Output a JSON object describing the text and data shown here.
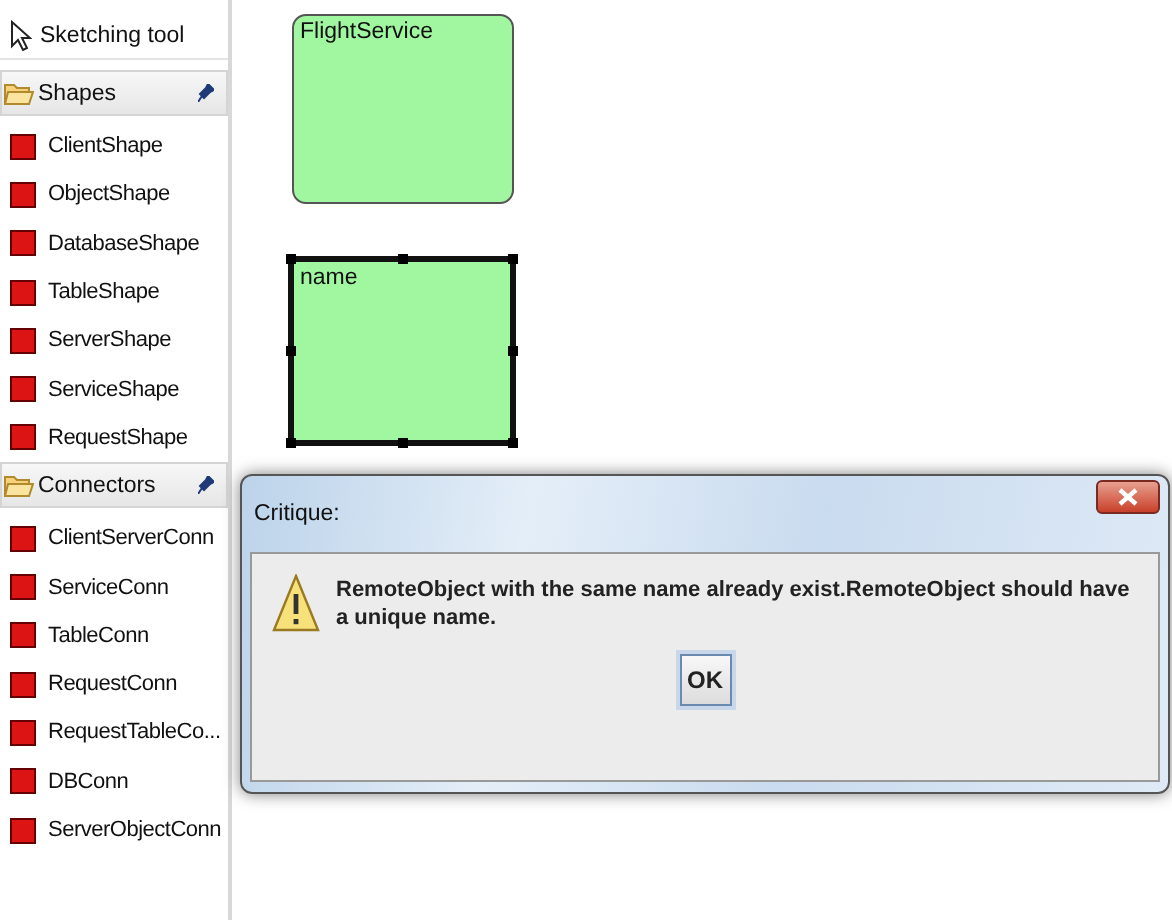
{
  "palette": {
    "tool": {
      "label": "Sketching tool"
    },
    "groups": [
      {
        "title": "Shapes",
        "items": [
          {
            "label": "ClientShape"
          },
          {
            "label": "ObjectShape"
          },
          {
            "label": "DatabaseShape"
          },
          {
            "label": "TableShape"
          },
          {
            "label": "ServerShape"
          },
          {
            "label": "ServiceShape"
          },
          {
            "label": "RequestShape"
          }
        ]
      },
      {
        "title": "Connectors",
        "items": [
          {
            "label": "ClientServerConn"
          },
          {
            "label": "ServiceConn"
          },
          {
            "label": "TableConn"
          },
          {
            "label": "RequestConn"
          },
          {
            "label": "RequestTableCo..."
          },
          {
            "label": "DBConn"
          },
          {
            "label": "ServerObjectConn"
          }
        ]
      }
    ]
  },
  "canvas": {
    "shapes": [
      {
        "label": "FlightService",
        "kind": "rounded",
        "selected": false
      },
      {
        "label": "name",
        "kind": "rect",
        "selected": true
      }
    ]
  },
  "dialog": {
    "title": "Critique:",
    "message": "RemoteObject with the same name already exist.RemoteObject should have a unique name.",
    "buttons": [
      "OK"
    ]
  }
}
